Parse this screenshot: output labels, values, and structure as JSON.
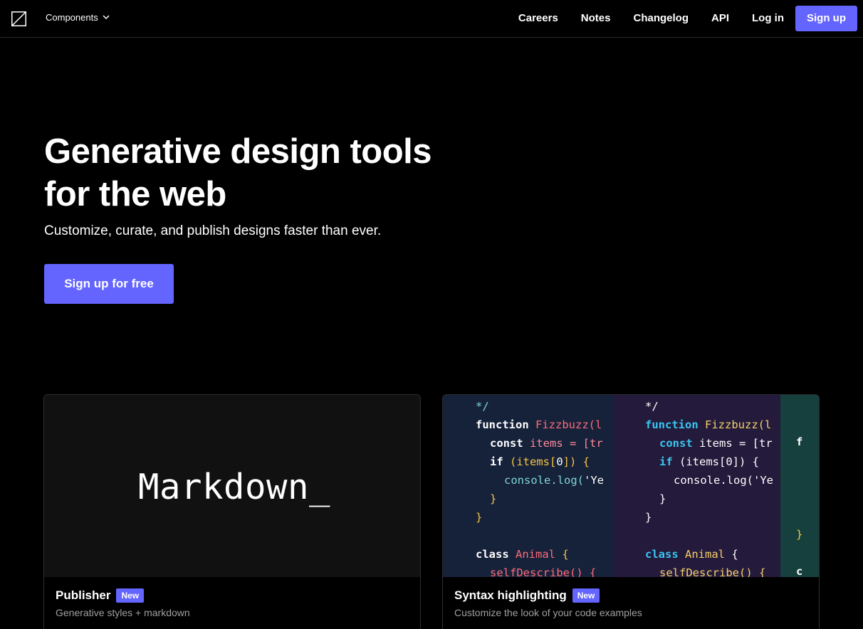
{
  "nav": {
    "menu_label": "Components",
    "links": [
      "Careers",
      "Notes",
      "Changelog",
      "API",
      "Log in"
    ],
    "signup_label": "Sign up",
    "icons": {
      "logo": "logo-icon",
      "menu_caret": "chevron-down-icon"
    }
  },
  "hero": {
    "title_line1": "Generative design tools",
    "title_line2": "for the web",
    "subtitle": "Customize, curate, and publish designs faster than ever.",
    "cta": "Sign up for free"
  },
  "cards": [
    {
      "media_text": "Markdown_",
      "title": "Publisher",
      "badge": "New",
      "description": "Generative styles + markdown"
    },
    {
      "title": "Syntax highlighting",
      "badge": "New",
      "description": "Customize the look of your code examples"
    }
  ],
  "code_preview": {
    "panel1_lines": [
      {
        "indent": 2,
        "parts": [
          {
            "t": "*/",
            "c": "#7fd8d0"
          }
        ]
      },
      {
        "indent": 2,
        "parts": [
          {
            "t": "function ",
            "c": "#ffffff",
            "b": true
          },
          {
            "t": "Fizzbuzz(l",
            "c": "#ff6b7a"
          }
        ]
      },
      {
        "indent": 3,
        "parts": [
          {
            "t": "const ",
            "c": "#ffffff",
            "b": true
          },
          {
            "t": "items = [tr",
            "c": "#ff8a9a"
          }
        ]
      },
      {
        "indent": 3,
        "parts": [
          {
            "t": "if ",
            "c": "#ffffff",
            "b": true
          },
          {
            "t": "(items[",
            "c": "#f5c542"
          },
          {
            "t": "0",
            "c": "#ffffff"
          },
          {
            "t": "]) {",
            "c": "#f5c542"
          }
        ]
      },
      {
        "indent": 4,
        "parts": [
          {
            "t": "console.log(",
            "c": "#7fd8d0"
          },
          {
            "t": "'Ye",
            "c": "#ffffff"
          }
        ]
      },
      {
        "indent": 3,
        "parts": [
          {
            "t": "}",
            "c": "#f5c542"
          }
        ]
      },
      {
        "indent": 2,
        "parts": [
          {
            "t": "}",
            "c": "#f5c542"
          }
        ]
      },
      {
        "indent": 0,
        "parts": [
          {
            "t": "",
            "c": "#ffffff"
          }
        ]
      },
      {
        "indent": 2,
        "parts": [
          {
            "t": "class ",
            "c": "#ffffff",
            "b": true
          },
          {
            "t": "Animal ",
            "c": "#ff6b7a"
          },
          {
            "t": "{",
            "c": "#f5c542"
          }
        ]
      },
      {
        "indent": 3,
        "parts": [
          {
            "t": "selfDescribe() {",
            "c": "#ff6b7a"
          }
        ]
      }
    ],
    "panel2_lines": [
      {
        "indent": 2,
        "parts": [
          {
            "t": "*/",
            "c": "#ffffff"
          }
        ]
      },
      {
        "indent": 2,
        "parts": [
          {
            "t": "function ",
            "c": "#39c6f0",
            "b": true
          },
          {
            "t": "Fizzbuzz(",
            "c": "#f5d06a"
          },
          {
            "t": "l",
            "c": "#f5d06a"
          }
        ]
      },
      {
        "indent": 3,
        "parts": [
          {
            "t": "const ",
            "c": "#39c6f0",
            "b": true
          },
          {
            "t": "items = [tr",
            "c": "#ffffff"
          }
        ]
      },
      {
        "indent": 3,
        "parts": [
          {
            "t": "if ",
            "c": "#39c6f0",
            "b": true
          },
          {
            "t": "(items[0]) {",
            "c": "#ffffff"
          }
        ]
      },
      {
        "indent": 4,
        "parts": [
          {
            "t": "console.log('Ye",
            "c": "#ffffff"
          }
        ]
      },
      {
        "indent": 3,
        "parts": [
          {
            "t": "}",
            "c": "#ffffff"
          }
        ]
      },
      {
        "indent": 2,
        "parts": [
          {
            "t": "}",
            "c": "#ffffff"
          }
        ]
      },
      {
        "indent": 0,
        "parts": [
          {
            "t": "",
            "c": "#ffffff"
          }
        ]
      },
      {
        "indent": 2,
        "parts": [
          {
            "t": "class ",
            "c": "#39c6f0",
            "b": true
          },
          {
            "t": "Animal ",
            "c": "#f5d06a"
          },
          {
            "t": "{",
            "c": "#ffffff"
          }
        ]
      },
      {
        "indent": 3,
        "parts": [
          {
            "t": "selfDescribe() {",
            "c": "#f5d06a"
          }
        ]
      }
    ],
    "panel3_lines": [
      {
        "indent": 2,
        "parts": [
          {
            "t": "",
            "c": "#ffffff"
          }
        ]
      },
      {
        "indent": 2,
        "parts": [
          {
            "t": "f",
            "c": "#ffffff",
            "b": true
          }
        ]
      },
      {
        "indent": 2,
        "parts": [
          {
            "t": "",
            "c": "#ffffff"
          }
        ]
      },
      {
        "indent": 2,
        "parts": [
          {
            "t": "",
            "c": "#ffffff"
          }
        ]
      },
      {
        "indent": 2,
        "parts": [
          {
            "t": "",
            "c": "#ffffff"
          }
        ]
      },
      {
        "indent": 2,
        "parts": [
          {
            "t": "",
            "c": "#ffffff"
          }
        ]
      },
      {
        "indent": 2,
        "parts": [
          {
            "t": "}",
            "c": "#f5c542"
          }
        ]
      },
      {
        "indent": 0,
        "parts": [
          {
            "t": "",
            "c": "#ffffff"
          }
        ]
      },
      {
        "indent": 2,
        "parts": [
          {
            "t": "c",
            "c": "#ffffff",
            "b": true
          }
        ]
      },
      {
        "indent": 2,
        "parts": [
          {
            "t": "",
            "c": "#ffffff"
          }
        ]
      }
    ]
  },
  "colors": {
    "accent": "#6464ff",
    "background": "#000000",
    "muted_text": "#a0a0a0"
  }
}
